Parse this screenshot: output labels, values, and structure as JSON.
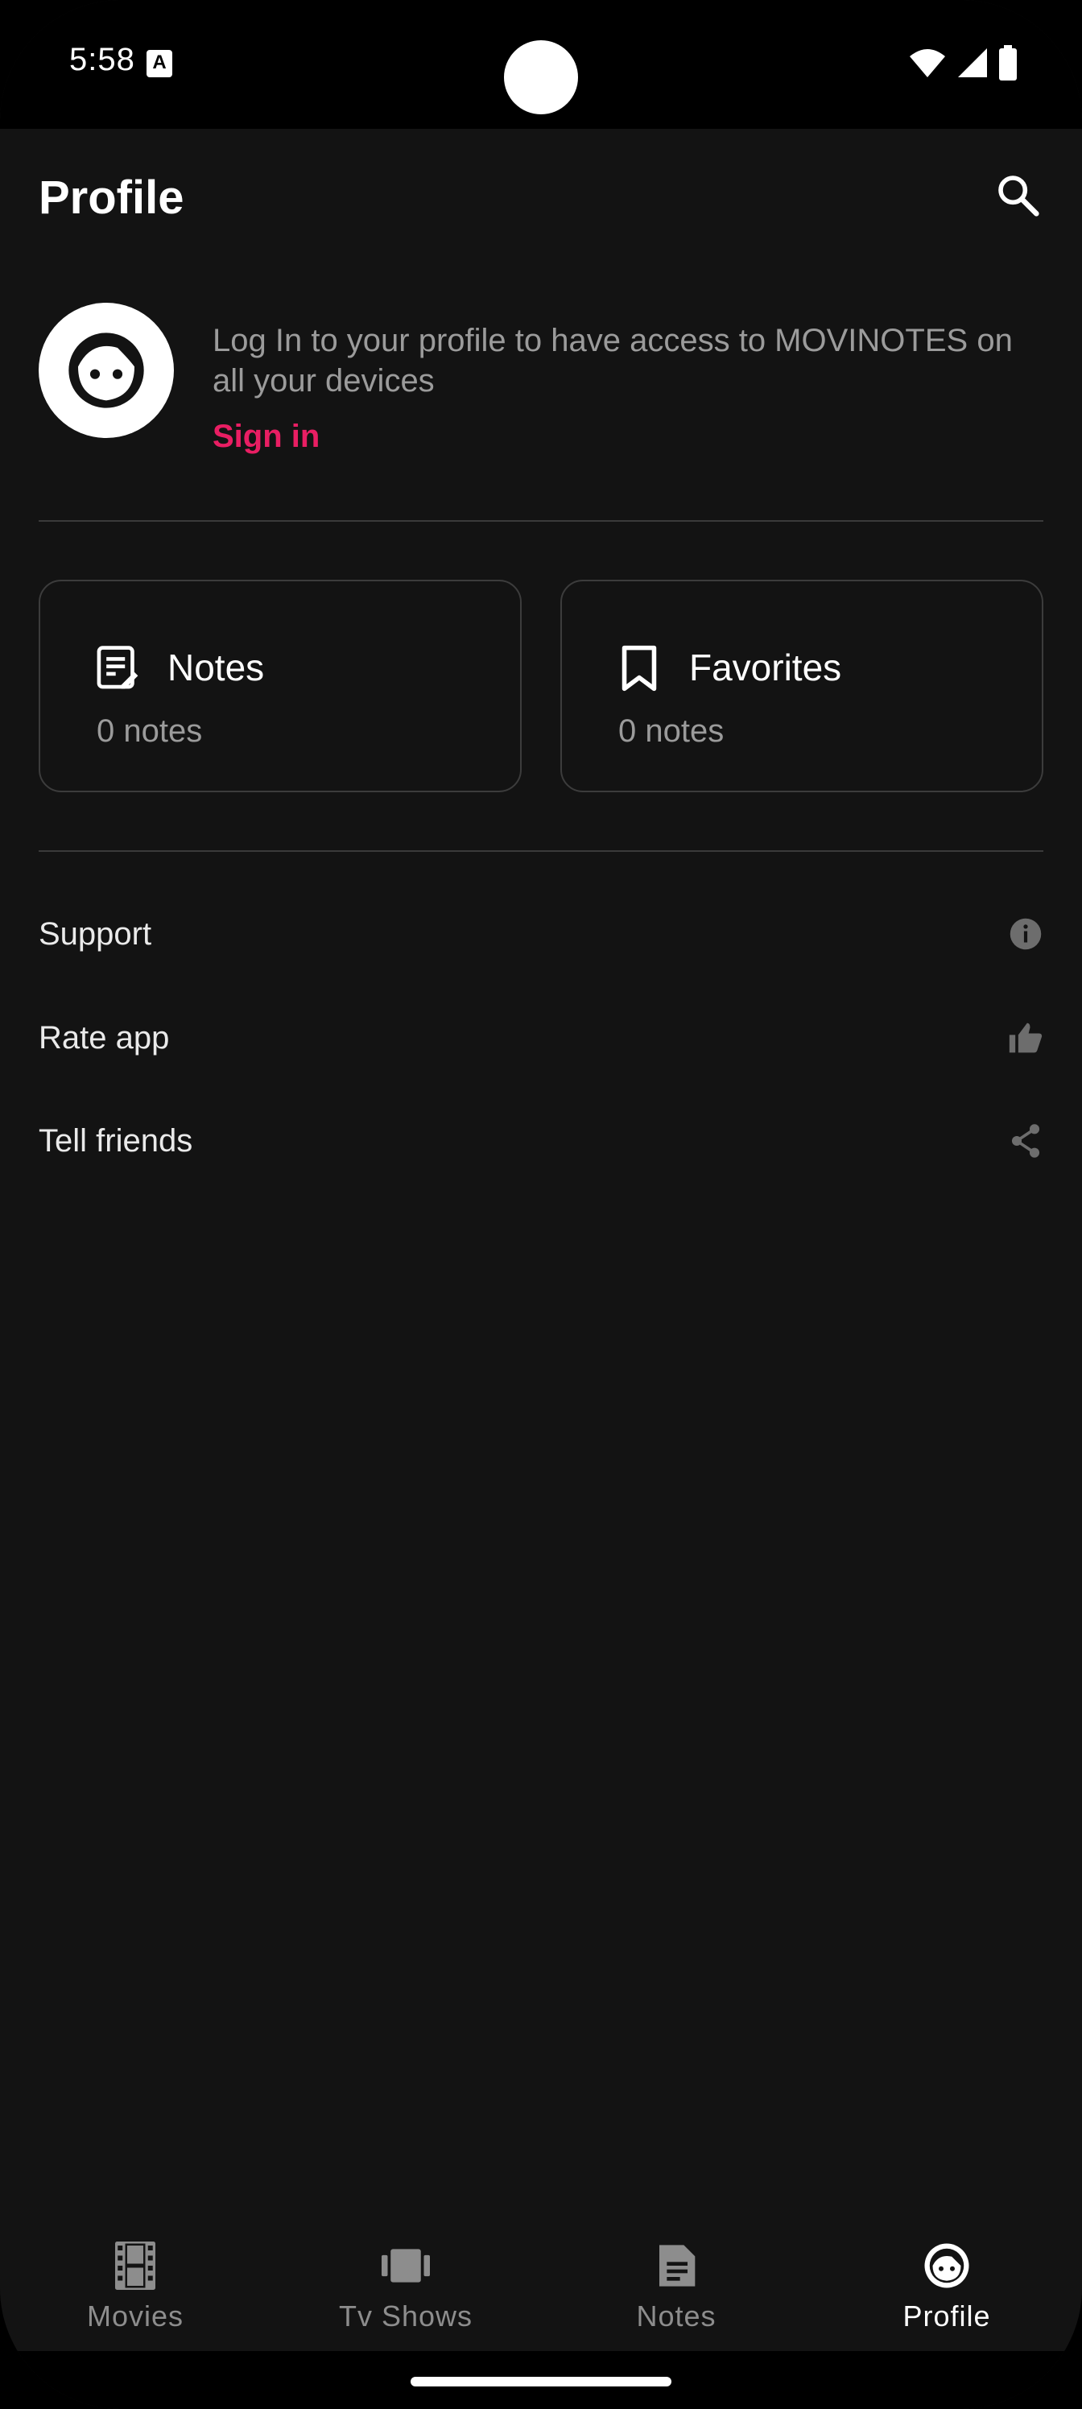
{
  "status_bar": {
    "time": "5:58",
    "notification_letter": "A",
    "icons": [
      "wifi-icon",
      "signal-icon",
      "battery-icon"
    ]
  },
  "app_bar": {
    "title": "Profile",
    "search_icon": "search-icon"
  },
  "profile": {
    "avatar_icon": "face-icon",
    "login_text": "Log In to your profile to have access to MOVINOTES on all your devices",
    "sign_in_label": "Sign in"
  },
  "cards": [
    {
      "title": "Notes",
      "count": "0 notes",
      "icon": "note-icon"
    },
    {
      "title": "Favorites",
      "count": "0 notes",
      "icon": "bookmark-icon"
    }
  ],
  "menu": [
    {
      "label": "Support",
      "icon": "info-icon"
    },
    {
      "label": "Rate app",
      "icon": "thumbs-up-icon"
    },
    {
      "label": "Tell friends",
      "icon": "share-icon"
    }
  ],
  "bottom_nav": [
    {
      "label": "Movies",
      "icon": "film-icon",
      "active": false
    },
    {
      "label": "Tv Shows",
      "icon": "carousel-icon",
      "active": false
    },
    {
      "label": "Notes",
      "icon": "document-icon",
      "active": false
    },
    {
      "label": "Profile",
      "icon": "face-icon",
      "active": true
    }
  ],
  "colors": {
    "background": "#131313",
    "accent": "#e91e63",
    "text_primary": "#ffffff",
    "text_secondary": "#9b9b9b"
  }
}
